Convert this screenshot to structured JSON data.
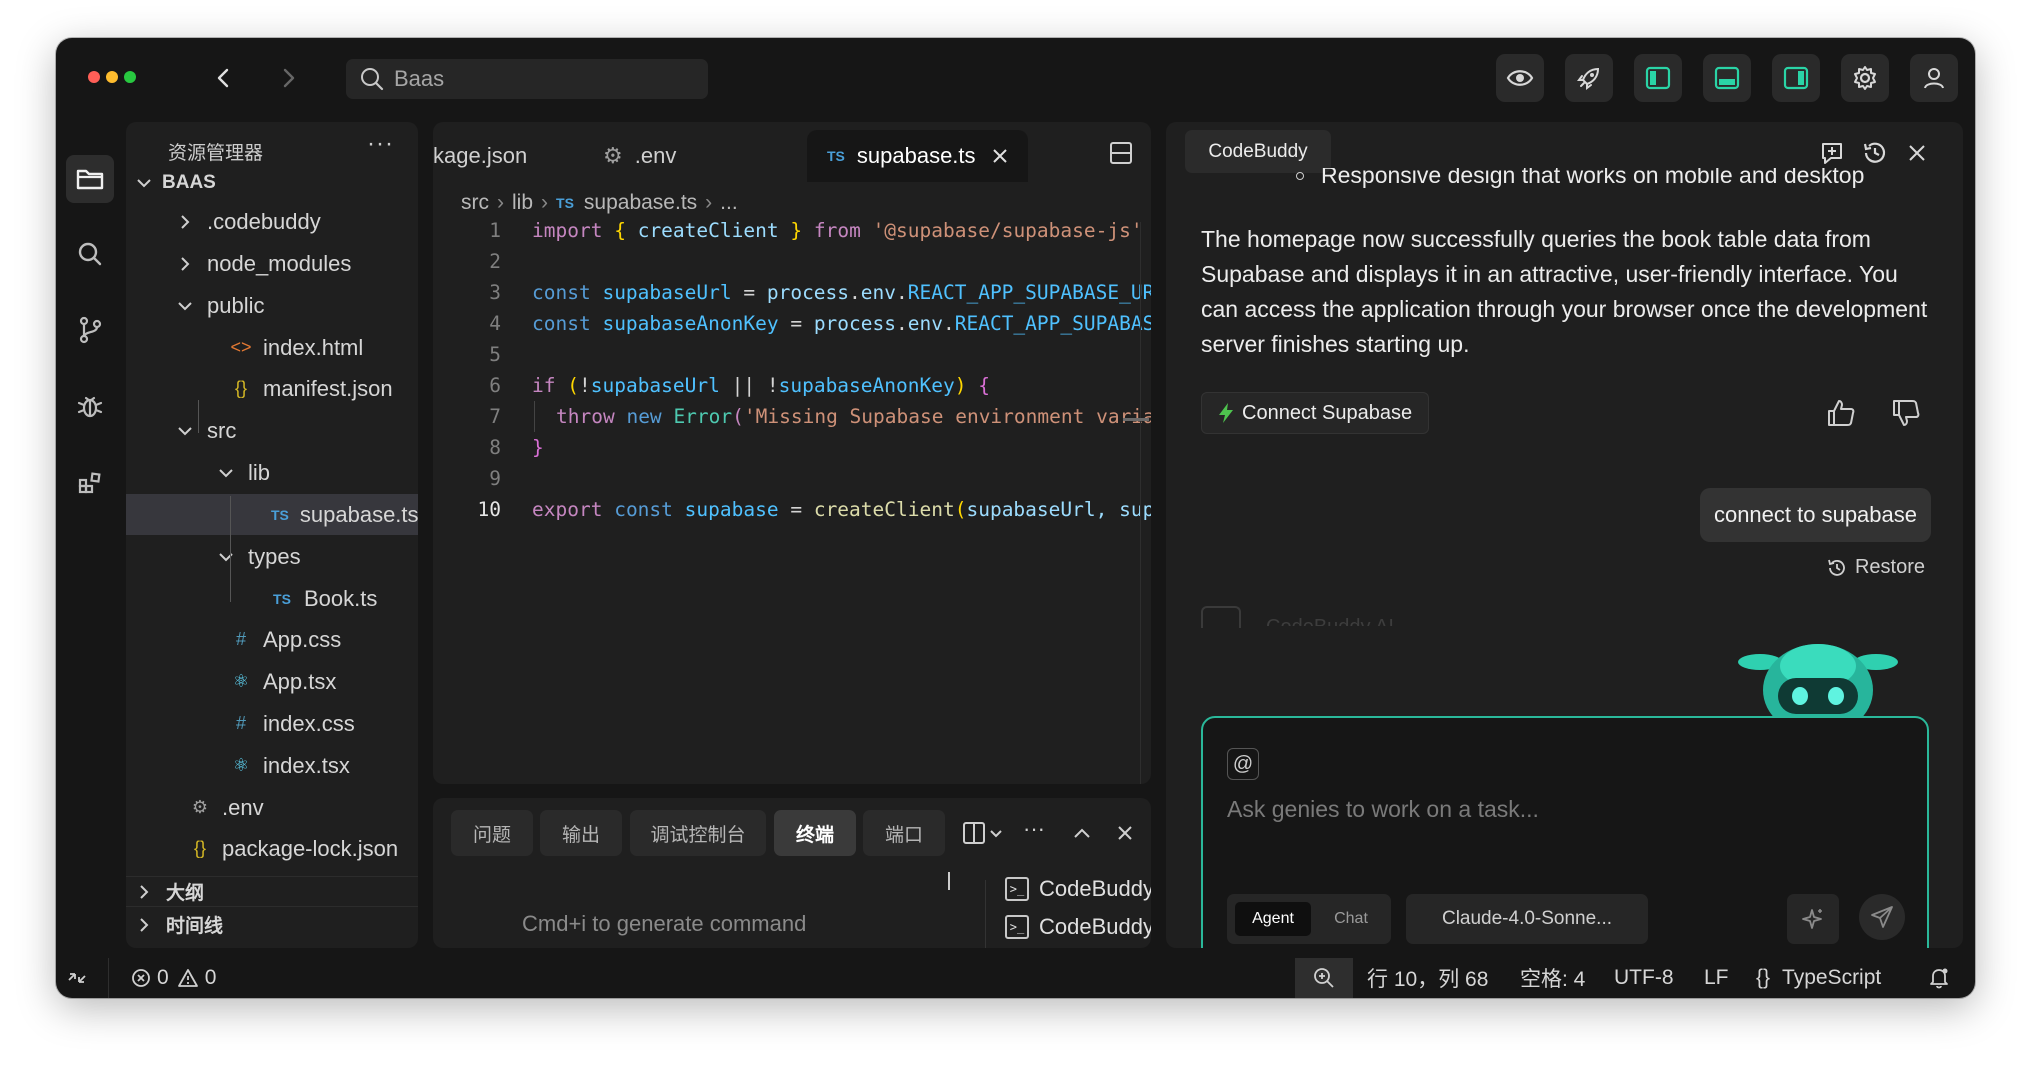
{
  "colors": {
    "traffic_close": "#ff5f57",
    "traffic_min": "#febc2e",
    "traffic_max": "#28c840",
    "accent_teal": "#2ab89a",
    "lightning": "#4ec44e"
  },
  "titlebar": {
    "search_value": "Baas",
    "buttons": [
      "eye-icon",
      "rocket-icon",
      "toggle-sidebar-left-icon",
      "toggle-panel-bottom-icon",
      "toggle-sidebar-right-icon",
      "settings-gear-icon",
      "user-icon"
    ]
  },
  "activity_bar": [
    "files-icon",
    "search-icon",
    "source-control-icon",
    "debug-icon",
    "extensions-icon"
  ],
  "explorer": {
    "title": "资源管理器",
    "more": "···",
    "root": "BAAS",
    "items": [
      {
        "label": ".codebuddy",
        "kind": "folder",
        "open": false
      },
      {
        "label": "node_modules",
        "kind": "folder",
        "open": false
      },
      {
        "label": "public",
        "kind": "folder",
        "open": true
      },
      {
        "label": "index.html",
        "kind": "file",
        "icon": "<>"
      },
      {
        "label": "manifest.json",
        "kind": "file",
        "icon": "{}"
      },
      {
        "label": "src",
        "kind": "folder",
        "open": true
      },
      {
        "label": "lib",
        "kind": "folder",
        "open": true
      },
      {
        "label": "supabase.ts",
        "kind": "file",
        "icon": "TS"
      },
      {
        "label": "types",
        "kind": "folder",
        "open": true
      },
      {
        "label": "Book.ts",
        "kind": "file",
        "icon": "TS"
      },
      {
        "label": "App.css",
        "kind": "file",
        "icon": "#"
      },
      {
        "label": "App.tsx",
        "kind": "file",
        "icon": "react"
      },
      {
        "label": "index.css",
        "kind": "file",
        "icon": "#"
      },
      {
        "label": "index.tsx",
        "kind": "file",
        "icon": "react"
      },
      {
        "label": ".env",
        "kind": "file",
        "icon": "gear"
      },
      {
        "label": "package-lock.json",
        "kind": "file",
        "icon": "{}"
      }
    ],
    "outline": "大纲",
    "timeline": "时间线"
  },
  "editor": {
    "tabs": [
      {
        "label": "kage.json"
      },
      {
        "label": ".env"
      },
      {
        "label": "supabase.ts",
        "prefix": "TS"
      }
    ],
    "tab_more": "···",
    "breadcrumb": [
      "src",
      "lib",
      "supabase.ts",
      "..."
    ],
    "breadcrumb_prefix": "TS",
    "line_numbers": [
      "1",
      "2",
      "3",
      "4",
      "5",
      "6",
      "7",
      "8",
      "9",
      "10"
    ],
    "current_line": "10",
    "code_text": {
      "l1_import": "import",
      "l1_brace_open": "{",
      "l1_name": "createClient",
      "l1_brace_close": "}",
      "l1_from": "from",
      "l1_str": "'@supabase/supabase-js'",
      "l3_const": "const",
      "l3_name": "supabaseUrl",
      "l3_eq": "=",
      "l3_process": "process",
      "l3_env": "env",
      "l3_var": "REACT_APP_SUPABASE_URL",
      "l4_const": "const",
      "l4_name": "supabaseAnonKey",
      "l4_eq": "=",
      "l4_process": "process",
      "l4_env": "env",
      "l4_var": "REACT_APP_SUPABASE_ANON_KEY",
      "l6_if": "if",
      "l6_paren_open": "(",
      "l6_not1": "!",
      "l6_a": "supabaseUrl",
      "l6_or": "||",
      "l6_not2": "!",
      "l6_b": "supabaseAnonKey",
      "l6_paren_close": ")",
      "l6_brace": "{",
      "l7_throw": "throw",
      "l7_new": "new",
      "l7_error": "Error",
      "l7_paren": "(",
      "l7_str": "'Missing Supabase environment variables'",
      "l8_brace": "}",
      "l10_export": "export",
      "l10_const": "const",
      "l10_name": "supabase",
      "l10_eq": "=",
      "l10_fn": "createClient",
      "l10_paren": "(",
      "l10_args": "supabaseUrl, supabaseAnonKey)"
    }
  },
  "panel": {
    "tabs": [
      "问题",
      "输出",
      "调试控制台",
      "终端",
      "端口"
    ],
    "active_tab": "终端",
    "hint": "Cmd+i to generate command",
    "terminals": [
      "CodeBuddy",
      "CodeBuddy"
    ],
    "more": "···"
  },
  "chat": {
    "pane_title": "CodeBuddy",
    "cut_line": "Responsive design that works on mobile and desktop",
    "message": "The homepage now successfully queries the book table data from Supabase and displays it in an attractive, user-friendly interface. You can access the application through your browser once the development server finishes starting up.",
    "connect_button": "Connect Supabase",
    "user_message": "connect to supabase",
    "restore": "Restore",
    "faded_label": "CodeBuddy AI",
    "input_placeholder": "Ask genies to work on a task...",
    "mode_agent": "Agent",
    "mode_chat": "Chat",
    "model": "Claude-4.0-Sonne..."
  },
  "statusbar": {
    "errors": "0",
    "warnings": "0",
    "position": "行 10，列 68",
    "spaces": "空格: 4",
    "encoding": "UTF-8",
    "eol": "LF",
    "language": "TypeScript"
  }
}
